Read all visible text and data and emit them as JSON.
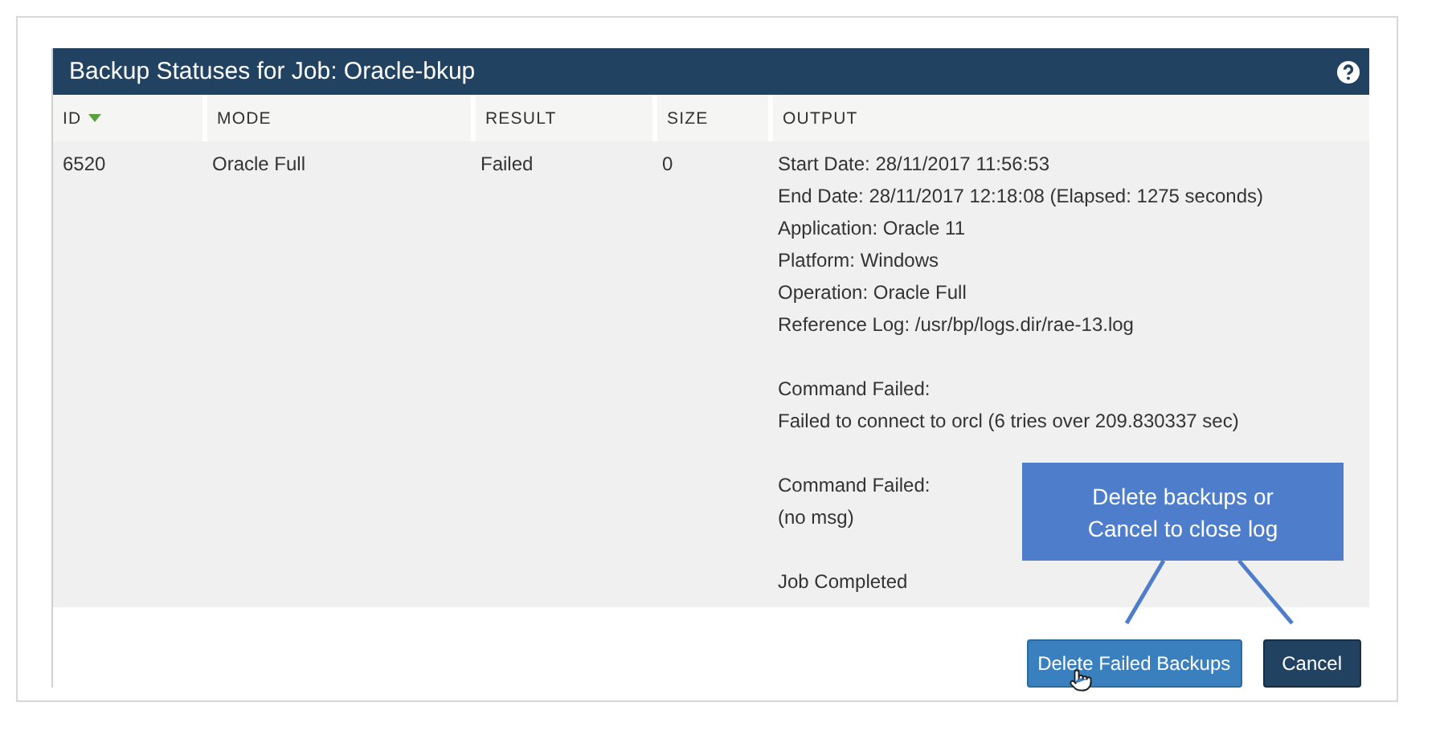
{
  "dialog": {
    "title": "Backup Statuses for Job: Oracle-bkup"
  },
  "table": {
    "columns": [
      {
        "label": "ID",
        "sorted": true
      },
      {
        "label": "MODE",
        "sorted": false
      },
      {
        "label": "RESULT",
        "sorted": false
      },
      {
        "label": "SIZE",
        "sorted": false
      },
      {
        "label": "OUTPUT",
        "sorted": false
      }
    ],
    "rows": [
      {
        "id": "6520",
        "mode": "Oracle Full",
        "result": "Failed",
        "size": "0",
        "output": [
          [
            "Start Date: 28/11/2017 11:56:53",
            "End Date: 28/11/2017 12:18:08 (Elapsed: 1275 seconds)",
            "Application: Oracle 11",
            "Platform: Windows",
            "Operation: Oracle Full",
            "Reference Log: /usr/bp/logs.dir/rae-13.log"
          ],
          [
            "Command Failed:",
            "Failed to connect to orcl (6 tries over 209.830337 sec)"
          ],
          [
            "Command Failed:",
            "(no msg)"
          ],
          [
            "Job Completed"
          ]
        ]
      }
    ]
  },
  "buttons": [
    {
      "label": "Delete Failed Backups",
      "kind": "primary"
    },
    {
      "label": "Cancel",
      "kind": "dark"
    }
  ],
  "callout": {
    "text": "Delete backups or Cancel to close log"
  }
}
